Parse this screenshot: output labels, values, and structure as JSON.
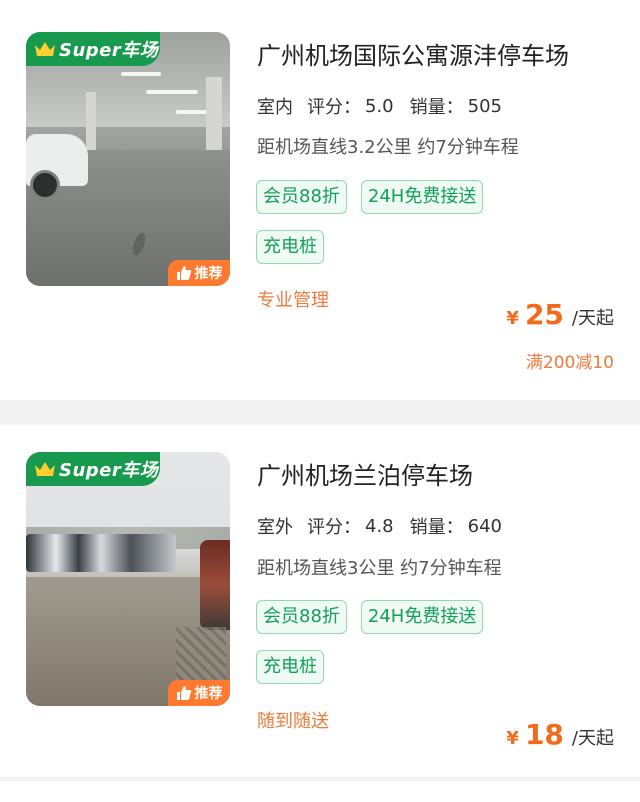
{
  "colors": {
    "brand_green": "#179a4e",
    "accent_orange": "#f26b1d",
    "tag_green": "#13a05a",
    "recommend_orange": "#ff7a2f"
  },
  "listings": [
    {
      "badge": "Super车场",
      "badge_icon": "crown-icon",
      "recommend": "推荐",
      "recommend_icon": "thumbs-up-icon",
      "title": "广州机场国际公寓源沣停车场",
      "type": "室内",
      "rating_label": "评分：",
      "rating": "5.0",
      "sales_label": "销量：",
      "sales": "505",
      "distance": "距机场直线3.2公里 约7分钟车程",
      "tags": [
        "会员88折",
        "24H免费接送",
        "充电桩"
      ],
      "feature": "专业管理",
      "currency": "¥",
      "price": "25",
      "unit": "/天起",
      "promo": "满200减10"
    },
    {
      "badge": "Super车场",
      "badge_icon": "crown-icon",
      "recommend": "推荐",
      "recommend_icon": "thumbs-up-icon",
      "title": "广州机场兰泊停车场",
      "type": "室外",
      "rating_label": "评分：",
      "rating": "4.8",
      "sales_label": "销量：",
      "sales": "640",
      "distance": "距机场直线3公里 约7分钟车程",
      "tags": [
        "会员88折",
        "24H免费接送",
        "充电桩"
      ],
      "feature": "随到随送",
      "currency": "¥",
      "price": "18",
      "unit": "/天起"
    }
  ]
}
